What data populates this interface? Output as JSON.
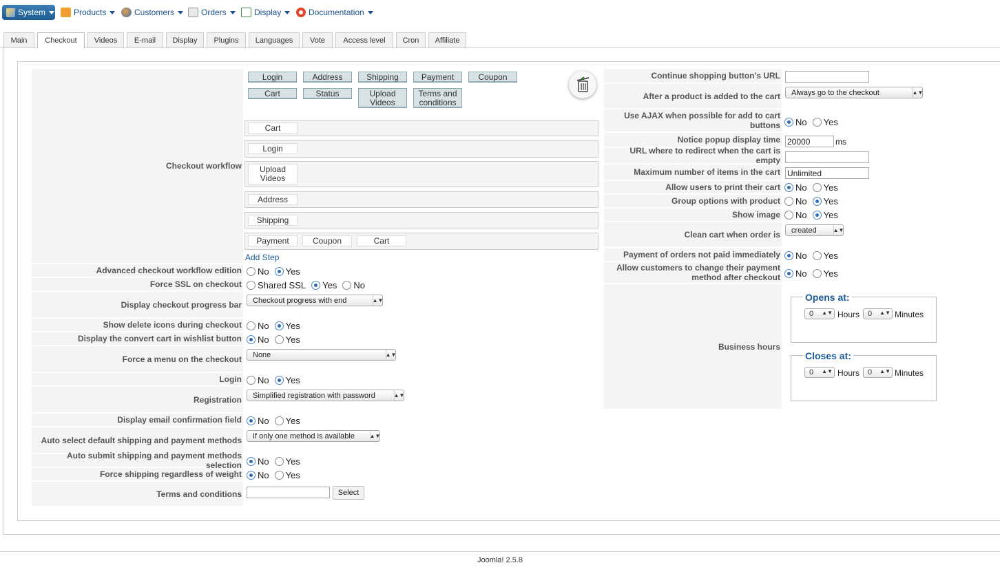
{
  "menu": {
    "system": "System",
    "products": "Products",
    "customers": "Customers",
    "orders": "Orders",
    "display": "Display",
    "documentation": "Documentation"
  },
  "tabs": [
    "Main",
    "Checkout",
    "Videos",
    "E-mail",
    "Display",
    "Plugins",
    "Languages",
    "Vote",
    "Access level",
    "Cron",
    "Affiliate"
  ],
  "workflow": {
    "label": "Checkout workflow",
    "palette": [
      "Login",
      "Address",
      "Shipping",
      "Payment",
      "Coupon",
      "Cart",
      "Status",
      "Upload Videos",
      "Terms and conditions"
    ],
    "steps": [
      [
        "Cart"
      ],
      [
        "Login"
      ],
      [
        "Upload Videos"
      ],
      [
        "Address"
      ],
      [
        "Shipping"
      ],
      [
        "Payment",
        "Coupon",
        "Cart"
      ]
    ],
    "add_step": "Add Step"
  },
  "left": {
    "advanced": {
      "label": "Advanced checkout workflow edition",
      "no": "No",
      "yes": "Yes"
    },
    "ssl": {
      "label": "Force SSL on checkout",
      "shared": "Shared SSL",
      "yes": "Yes",
      "no": "No"
    },
    "progress": {
      "label": "Display checkout progress bar",
      "value": "Checkout progress with end"
    },
    "delete_icons": {
      "label": "Show delete icons during checkout",
      "no": "No",
      "yes": "Yes"
    },
    "wishlist": {
      "label": "Display the convert cart in wishlist button",
      "no": "No",
      "yes": "Yes"
    },
    "force_menu": {
      "label": "Force a menu on the checkout",
      "value": "None"
    },
    "login": {
      "label": "Login",
      "no": "No",
      "yes": "Yes"
    },
    "registration": {
      "label": "Registration",
      "value": "Simplified registration with password"
    },
    "email_confirm": {
      "label": "Display email confirmation field",
      "no": "No",
      "yes": "Yes"
    },
    "auto_select": {
      "label": "Auto select default shipping and payment methods",
      "value": "If only one method is available"
    },
    "auto_submit": {
      "label": "Auto submit shipping and payment methods selection",
      "no": "No",
      "yes": "Yes"
    },
    "force_shipping": {
      "label": "Force shipping regardless of weight",
      "no": "No",
      "yes": "Yes"
    },
    "terms": {
      "label": "Terms and conditions",
      "button": "Select"
    }
  },
  "right": {
    "continue_url": {
      "label": "Continue shopping button's URL"
    },
    "after_add": {
      "label": "After a product is added to the cart",
      "value": "Always go to the checkout"
    },
    "ajax": {
      "label": "Use AJAX when possible for add to cart buttons",
      "no": "No",
      "yes": "Yes"
    },
    "popup": {
      "label": "Notice popup display time",
      "value": "20000",
      "unit": "ms"
    },
    "redirect": {
      "label": "URL where to redirect when the cart is empty"
    },
    "max_items": {
      "label": "Maximum number of items in the cart",
      "value": "Unlimited"
    },
    "print_cart": {
      "label": "Allow users to print their cart",
      "no": "No",
      "yes": "Yes"
    },
    "group_opts": {
      "label": "Group options with product",
      "no": "No",
      "yes": "Yes"
    },
    "show_image": {
      "label": "Show image",
      "no": "No",
      "yes": "Yes"
    },
    "clean_cart": {
      "label": "Clean cart when order is",
      "value": "created"
    },
    "not_paid": {
      "label": "Payment of orders not paid immediately",
      "no": "No",
      "yes": "Yes"
    },
    "change_payment": {
      "label": "Allow customers to change their payment method after checkout",
      "no": "No",
      "yes": "Yes"
    },
    "business_hours": {
      "label": "Business hours",
      "opens": "Opens at:",
      "closes": "Closes at:",
      "hours": "Hours",
      "minutes": "Minutes",
      "open_h": "0",
      "open_m": "0",
      "close_h": "0",
      "close_m": "0"
    }
  },
  "footer": "Joomla! 2.5.8"
}
